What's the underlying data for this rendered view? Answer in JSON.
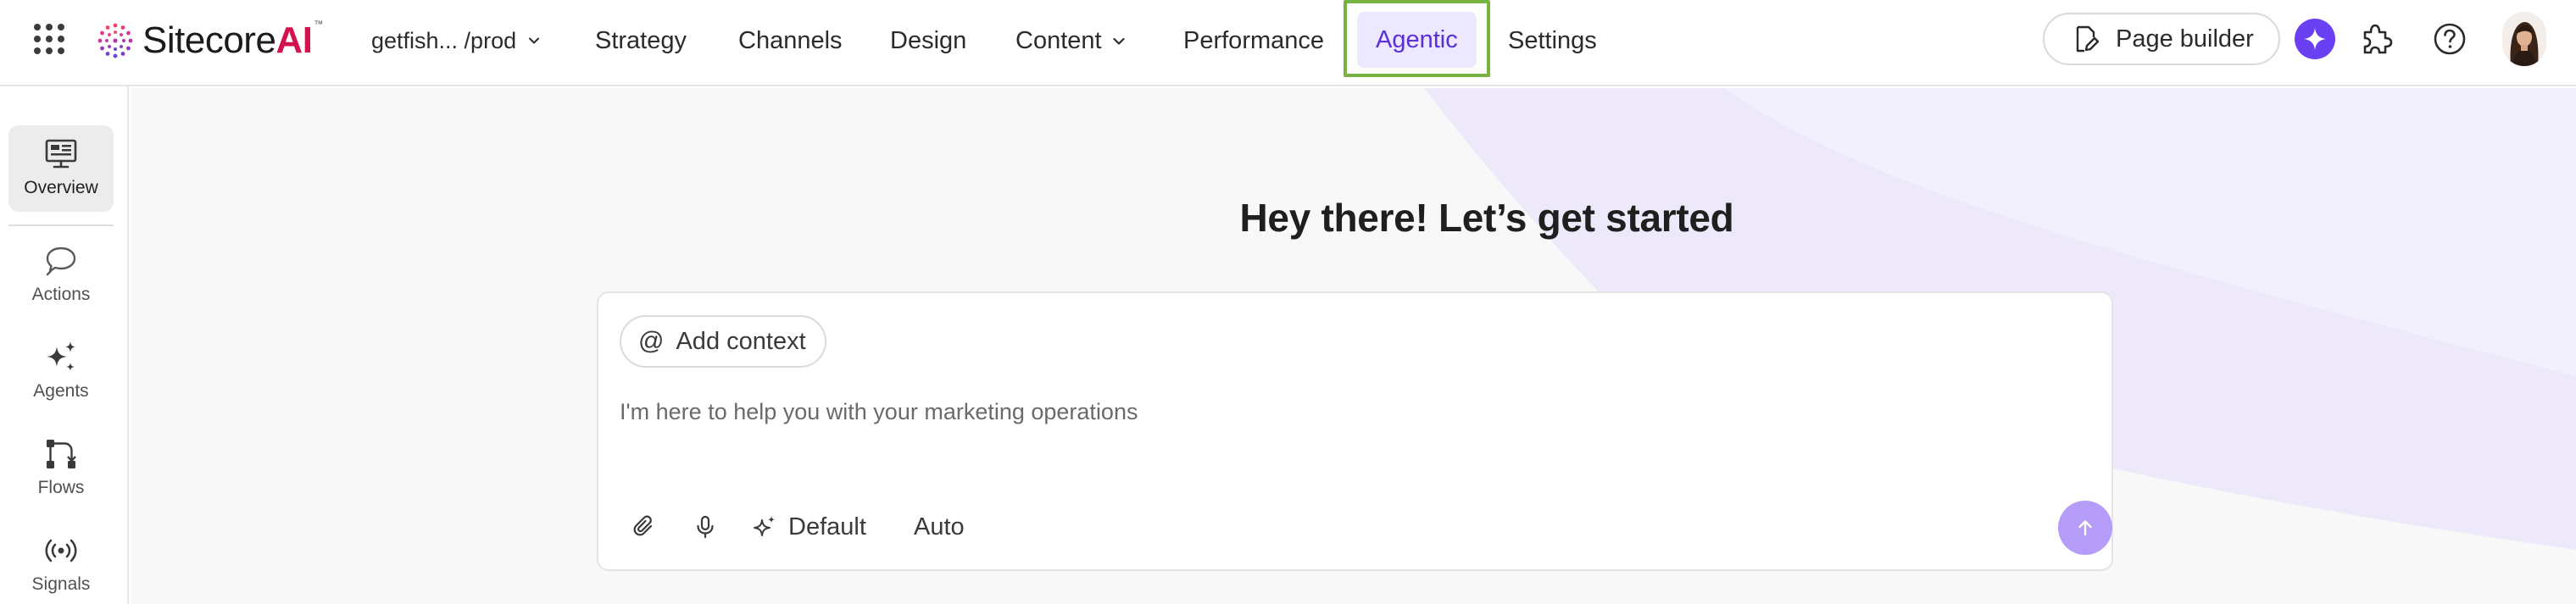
{
  "app": {
    "brand_prefix": "Sitecore",
    "brand_suffix": "AI",
    "brand_tm": "™",
    "environment": "getfish... /prod"
  },
  "nav": {
    "items": [
      {
        "label": "Strategy"
      },
      {
        "label": "Channels"
      },
      {
        "label": "Design"
      },
      {
        "label": "Content"
      },
      {
        "label": "Performance"
      },
      {
        "label": "Agentic"
      },
      {
        "label": "Settings"
      }
    ],
    "active": "Agentic",
    "page_builder_label": "Page builder"
  },
  "sidebar": {
    "items": [
      {
        "label": "Overview",
        "icon": "monitor-icon"
      },
      {
        "label": "Actions",
        "icon": "chat-bubble-icon"
      },
      {
        "label": "Agents",
        "icon": "sparkles-icon"
      },
      {
        "label": "Flows",
        "icon": "flow-icon"
      },
      {
        "label": "Signals",
        "icon": "signal-icon"
      }
    ],
    "active": "Overview"
  },
  "main": {
    "greeting": "Hey there! Let’s get started",
    "add_context_label": "Add context",
    "input_placeholder": "I'm here to help you with your marketing operations",
    "model_label": "Default",
    "mode_label": "Auto"
  },
  "colors": {
    "accent": "#6b3ff2",
    "active_tab_bg": "#ebe8ff",
    "active_tab_text": "#5a2fd6",
    "highlight_outline": "#77b341",
    "send_button": "#b49cf8",
    "brand_ai": "#d4124d"
  }
}
